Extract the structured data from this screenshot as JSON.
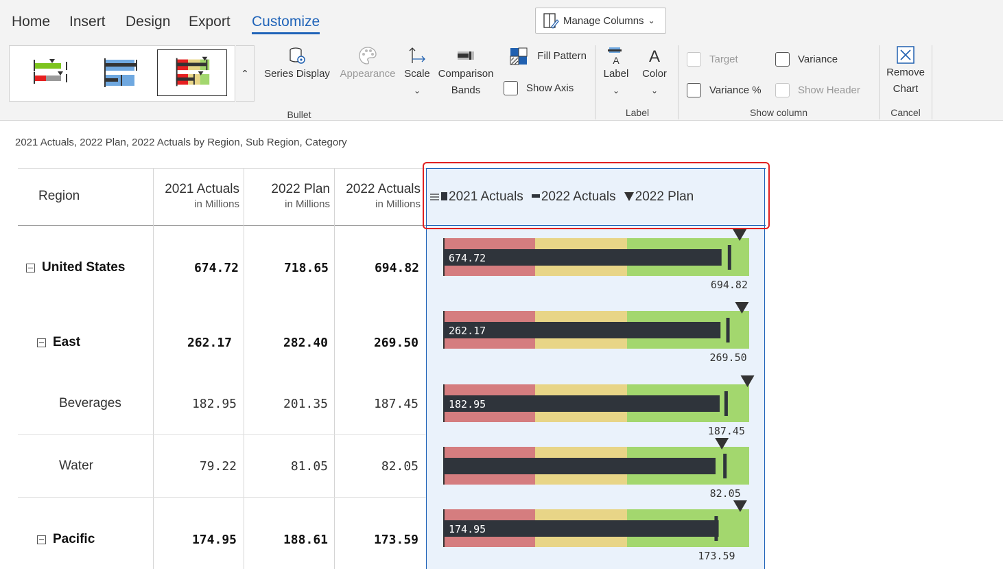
{
  "tabs": [
    {
      "label": "Home",
      "active": false
    },
    {
      "label": "Insert",
      "active": false
    },
    {
      "label": "Design",
      "active": false
    },
    {
      "label": "Export",
      "active": false
    },
    {
      "label": "Customize",
      "active": true
    }
  ],
  "manage_columns": {
    "label": "Manage Columns",
    "icon": "column-edit-icon"
  },
  "ribbon": {
    "bullet": {
      "group_label": "Bullet",
      "series_display": "Series Display",
      "appearance": "Appearance",
      "scale": "Scale",
      "comparison_bands": [
        "Comparison",
        "Bands"
      ],
      "fill_pattern": "Fill Pattern",
      "show_axis": "Show Axis"
    },
    "label_group": {
      "group_label": "Label",
      "label": "Label",
      "color": "Color"
    },
    "show_column": {
      "group_label": "Show column",
      "target": "Target",
      "variance": "Variance",
      "variance_pct": "Variance %",
      "show_header": "Show Header"
    },
    "cancel": {
      "group_label": "Cancel",
      "remove_chart": [
        "Remove",
        "Chart"
      ]
    }
  },
  "subtitle": "2021 Actuals, 2022 Plan, 2022 Actuals by Region, Sub Region, Category",
  "table": {
    "region_header": "Region",
    "columns": [
      {
        "title": "2021 Actuals",
        "unit": "in Millions"
      },
      {
        "title": "2022 Plan",
        "unit": "in Millions"
      },
      {
        "title": "2022 Actuals",
        "unit": "in Millions"
      }
    ],
    "legend": {
      "actual_2021": "2021 Actuals",
      "actual_2022": "2022 Actuals",
      "plan_2022": "2022 Plan"
    },
    "rows": [
      {
        "label": "United States",
        "level": 0,
        "bold": true,
        "expandable": true,
        "a2021": "674.72",
        "plan2022": "718.65",
        "a2022": "694.82"
      },
      {
        "label": "East",
        "level": 1,
        "bold": true,
        "expandable": true,
        "a2021": "262.17",
        "plan2022": "282.40",
        "a2022": "269.50"
      },
      {
        "label": "Beverages",
        "level": 2,
        "bold": false,
        "expandable": false,
        "a2021": "182.95",
        "plan2022": "201.35",
        "a2022": "187.45"
      },
      {
        "label": "Water",
        "level": 2,
        "bold": false,
        "expandable": false,
        "a2021": "79.22",
        "plan2022": "81.05",
        "a2022": "82.05"
      },
      {
        "label": "Pacific",
        "level": 1,
        "bold": true,
        "expandable": true,
        "a2021": "174.95",
        "plan2022": "188.61",
        "a2022": "173.59"
      }
    ]
  },
  "chart_data": {
    "type": "bar",
    "subtype": "bullet",
    "categories": [
      "United States",
      "East",
      "Beverages",
      "Water",
      "Pacific"
    ],
    "series": [
      {
        "name": "2021 Actuals",
        "values": [
          674.72,
          262.17,
          182.95,
          79.22,
          174.95
        ]
      },
      {
        "name": "2022 Actuals",
        "values": [
          694.82,
          269.5,
          187.45,
          82.05,
          173.59
        ]
      },
      {
        "name": "2022 Plan",
        "values": [
          718.65,
          282.4,
          201.35,
          81.05,
          188.61
        ]
      }
    ],
    "bar_labels": [
      "674.72",
      "262.17",
      "182.95",
      "",
      "174.95"
    ],
    "target_labels": [
      "694.82",
      "269.50",
      "187.45",
      "82.05",
      "173.59"
    ],
    "band_colors": [
      "#d57d7f",
      "#e8d587",
      "#a3d76e"
    ],
    "bar_color": "#2f343b",
    "marker_color": "#333333"
  }
}
